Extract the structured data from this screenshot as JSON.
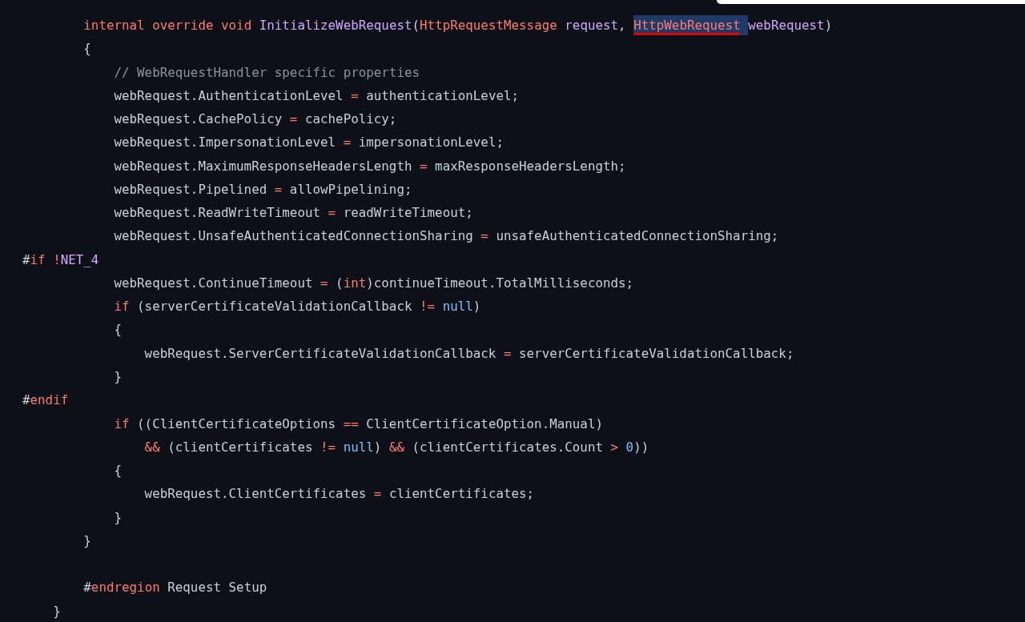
{
  "code_view": {
    "lines": [
      {
        "tokens": [
          {
            "kind": "keyword",
            "text": "        internal "
          },
          {
            "kind": "keyword",
            "text": "override "
          },
          {
            "kind": "keyword",
            "text": "void "
          },
          {
            "kind": "entity",
            "text": "InitializeWebRequest"
          },
          {
            "kind": "text",
            "text": "("
          },
          {
            "kind": "keyword",
            "text": "HttpRequestMessage "
          },
          {
            "kind": "entity",
            "text": "request"
          },
          {
            "kind": "text",
            "text": ", "
          },
          {
            "kind": "keyword",
            "text": "HttpWebRequest ",
            "highlighted": true,
            "underlined": true
          },
          {
            "kind": "entity",
            "text": "webRequest"
          },
          {
            "kind": "text",
            "text": ")"
          }
        ]
      },
      {
        "tokens": [
          {
            "kind": "text",
            "text": "        {"
          }
        ]
      },
      {
        "tokens": [
          {
            "kind": "comment",
            "text": "            // WebRequestHandler specific properties"
          }
        ]
      },
      {
        "tokens": [
          {
            "kind": "text",
            "text": "            webRequest.AuthenticationLevel "
          },
          {
            "kind": "keyword",
            "text": "="
          },
          {
            "kind": "text",
            "text": " authenticationLevel;"
          }
        ]
      },
      {
        "tokens": [
          {
            "kind": "text",
            "text": "            webRequest.CachePolicy "
          },
          {
            "kind": "keyword",
            "text": "="
          },
          {
            "kind": "text",
            "text": " cachePolicy;"
          }
        ]
      },
      {
        "tokens": [
          {
            "kind": "text",
            "text": "            webRequest.ImpersonationLevel "
          },
          {
            "kind": "keyword",
            "text": "="
          },
          {
            "kind": "text",
            "text": " impersonationLevel;"
          }
        ]
      },
      {
        "tokens": [
          {
            "kind": "text",
            "text": "            webRequest.MaximumResponseHeadersLength "
          },
          {
            "kind": "keyword",
            "text": "="
          },
          {
            "kind": "text",
            "text": " maxResponseHeadersLength;"
          }
        ]
      },
      {
        "tokens": [
          {
            "kind": "text",
            "text": "            webRequest.Pipelined "
          },
          {
            "kind": "keyword",
            "text": "="
          },
          {
            "kind": "text",
            "text": " allowPipelining;"
          }
        ]
      },
      {
        "tokens": [
          {
            "kind": "text",
            "text": "            webRequest.ReadWriteTimeout "
          },
          {
            "kind": "keyword",
            "text": "="
          },
          {
            "kind": "text",
            "text": " readWriteTimeout;"
          }
        ]
      },
      {
        "tokens": [
          {
            "kind": "text",
            "text": "            webRequest.UnsafeAuthenticatedConnectionSharing "
          },
          {
            "kind": "keyword",
            "text": "="
          },
          {
            "kind": "text",
            "text": " unsafeAuthenticatedConnectionSharing;"
          }
        ]
      },
      {
        "tokens": [
          {
            "kind": "text",
            "text": "#"
          },
          {
            "kind": "keyword",
            "text": "if "
          },
          {
            "kind": "keyword",
            "text": "!"
          },
          {
            "kind": "entity",
            "text": "NET_4"
          }
        ]
      },
      {
        "tokens": [
          {
            "kind": "text",
            "text": "            webRequest.ContinueTimeout "
          },
          {
            "kind": "keyword",
            "text": "="
          },
          {
            "kind": "text",
            "text": " ("
          },
          {
            "kind": "keyword",
            "text": "int"
          },
          {
            "kind": "text",
            "text": ")continueTimeout.TotalMilliseconds;"
          }
        ]
      },
      {
        "tokens": [
          {
            "kind": "keyword",
            "text": "            if"
          },
          {
            "kind": "text",
            "text": " (serverCertificateValidationCallback "
          },
          {
            "kind": "keyword",
            "text": "!= "
          },
          {
            "kind": "constant",
            "text": "null"
          },
          {
            "kind": "text",
            "text": ")"
          }
        ]
      },
      {
        "tokens": [
          {
            "kind": "text",
            "text": "            {"
          }
        ]
      },
      {
        "tokens": [
          {
            "kind": "text",
            "text": "                webRequest.ServerCertificateValidationCallback "
          },
          {
            "kind": "keyword",
            "text": "="
          },
          {
            "kind": "text",
            "text": " serverCertificateValidationCallback;"
          }
        ]
      },
      {
        "tokens": [
          {
            "kind": "text",
            "text": "            }"
          }
        ]
      },
      {
        "tokens": [
          {
            "kind": "text",
            "text": "#"
          },
          {
            "kind": "keyword",
            "text": "endif"
          }
        ]
      },
      {
        "tokens": [
          {
            "kind": "keyword",
            "text": "            if"
          },
          {
            "kind": "text",
            "text": " ((ClientCertificateOptions "
          },
          {
            "kind": "keyword",
            "text": "=="
          },
          {
            "kind": "text",
            "text": " ClientCertificateOption.Manual)"
          }
        ]
      },
      {
        "tokens": [
          {
            "kind": "keyword",
            "text": "                &&"
          },
          {
            "kind": "text",
            "text": " (clientCertificates "
          },
          {
            "kind": "keyword",
            "text": "!= "
          },
          {
            "kind": "constant",
            "text": "null"
          },
          {
            "kind": "text",
            "text": ") "
          },
          {
            "kind": "keyword",
            "text": "&&"
          },
          {
            "kind": "text",
            "text": " (clientCertificates.Count "
          },
          {
            "kind": "keyword",
            "text": "> "
          },
          {
            "kind": "constant",
            "text": "0"
          },
          {
            "kind": "text",
            "text": "))"
          }
        ]
      },
      {
        "tokens": [
          {
            "kind": "text",
            "text": "            {"
          }
        ]
      },
      {
        "tokens": [
          {
            "kind": "text",
            "text": "                webRequest.ClientCertificates "
          },
          {
            "kind": "keyword",
            "text": "="
          },
          {
            "kind": "text",
            "text": " clientCertificates;"
          }
        ]
      },
      {
        "tokens": [
          {
            "kind": "text",
            "text": "            }"
          }
        ]
      },
      {
        "tokens": [
          {
            "kind": "text",
            "text": "        }"
          }
        ]
      },
      {
        "gap_before": true,
        "tokens": [
          {
            "kind": "text",
            "text": "        #"
          },
          {
            "kind": "keyword",
            "text": "endregion"
          },
          {
            "kind": "text",
            "text": " Request Setup"
          }
        ]
      },
      {
        "tokens": [
          {
            "kind": "text",
            "text": "    }"
          }
        ]
      }
    ]
  }
}
